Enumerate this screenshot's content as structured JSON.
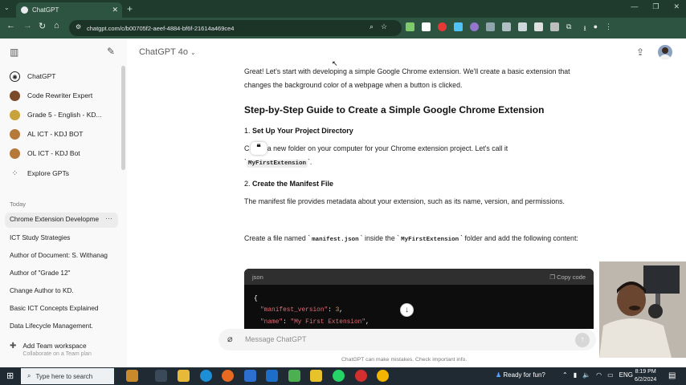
{
  "browser": {
    "tab_title": "ChatGPT",
    "new_tab": "+",
    "url": "chatgpt.com/c/b00705f2-aeef-4884-bf6f-21614a469ce4"
  },
  "sidebar": {
    "items": [
      {
        "label": "ChatGPT",
        "color": "#222222"
      },
      {
        "label": "Code Rewriter Expert",
        "color": "#7a4a2a"
      },
      {
        "label": "Grade 5 - English - KD...",
        "color": "#c9a23b"
      },
      {
        "label": "AL ICT - KDJ BOT",
        "color": "#b5793a"
      },
      {
        "label": "OL ICT - KDJ Bot",
        "color": "#b5793a"
      },
      {
        "label": "Explore GPTs",
        "color": "#555555"
      }
    ],
    "today_label": "Today",
    "history": [
      "Chrome Extension Developme",
      "ICT Study Strategies",
      "Author of Document: S. Withanag",
      "Author of \"Grade 12\"",
      "Change Author to KD.",
      "Basic ICT Concepts Explained",
      "Data Lifecycle Management."
    ],
    "team_title": "Add Team workspace",
    "team_subtitle": "Collaborate on a Team plan"
  },
  "header": {
    "model": "ChatGPT 4o"
  },
  "content": {
    "intro": "Great! Let's start with developing a simple Google Chrome extension. We'll create a basic extension that changes the background color of a webpage when a button is clicked.",
    "heading": "Step-by-Step Guide to Create a Simple Google Chrome Extension",
    "step1_num": "1.",
    "step1_title": "Set Up Your Project Directory",
    "step1_text_a": "C",
    "step1_text_b": " a new folder on your computer for your Chrome extension project. Let's call it",
    "step1_code": "MyFirstExtension",
    "step1_tick_open": "`",
    "step1_tick_close": "`.",
    "quote_icon": "❝",
    "step2_num": "2.",
    "step2_title": "Create the Manifest File",
    "step2_text": "The manifest file provides metadata about your extension, such as its name, version, and permissions.",
    "create_a": "Create a file named ",
    "create_code1": "manifest.json",
    "create_b": " inside the ",
    "create_code2": "MyFirstExtension",
    "create_c": " folder and add the following content:",
    "tick": "`"
  },
  "codeblock": {
    "lang": "json",
    "copy": "Copy code",
    "line1": "{",
    "l2_key": "\"manifest_version\"",
    "l2_sep": ": ",
    "l2_val": "3",
    "l2_end": ",",
    "l3_key": "\"name\"",
    "l3_sep": ": ",
    "l3_val": "\"My First Extension\"",
    "l3_end": ","
  },
  "composer": {
    "placeholder": "Message ChatGPT",
    "disclaimer": "ChatGPT can make mistakes. Check important info."
  },
  "taskbar": {
    "search": "Type here to search",
    "weather": "Ready for fun?",
    "lang": "ENG",
    "time": "8:19 PM",
    "date": "6/2/2024"
  }
}
